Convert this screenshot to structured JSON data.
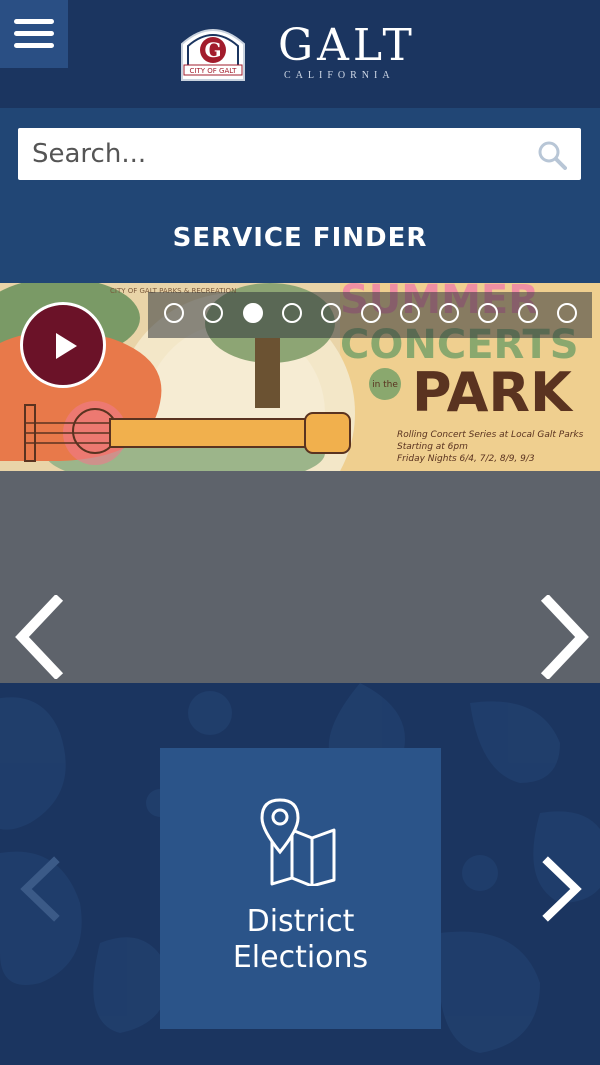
{
  "header": {
    "logo_title": "GALT",
    "logo_subtitle": "CALIFORNIA",
    "seal_text": "CITY OF GALT",
    "menu_icon": "hamburger-icon"
  },
  "search": {
    "placeholder": "Search...",
    "icon": "search-icon"
  },
  "service_finder": {
    "label": "SERVICE FINDER"
  },
  "slideshow": {
    "slide_count": 11,
    "active_index": 2,
    "banner": {
      "org_text": "CITY OF GALT PARKS & RECREATION",
      "headline_top": "SUMMER",
      "headline_mid": "CONCERTS",
      "in_the": "in the",
      "headline_bottom": "PARK",
      "detail_line1": "Rolling Concert Series at Local Galt Parks",
      "detail_line2": "Starting at 6pm",
      "detail_line3": "Friday Nights 6/4, 7/2, 8/9, 9/3"
    },
    "prev_icon": "chevron-left-icon",
    "next_icon": "chevron-right-icon",
    "play_icon": "play-icon"
  },
  "quick_links": {
    "tile": {
      "icon": "map-pin-icon",
      "line1": "District",
      "line2": "Elections"
    }
  },
  "colors": {
    "navy": "#1b3560",
    "blue_band": "#214675",
    "tile": "#2b5489",
    "play_button": "#6b1228"
  }
}
